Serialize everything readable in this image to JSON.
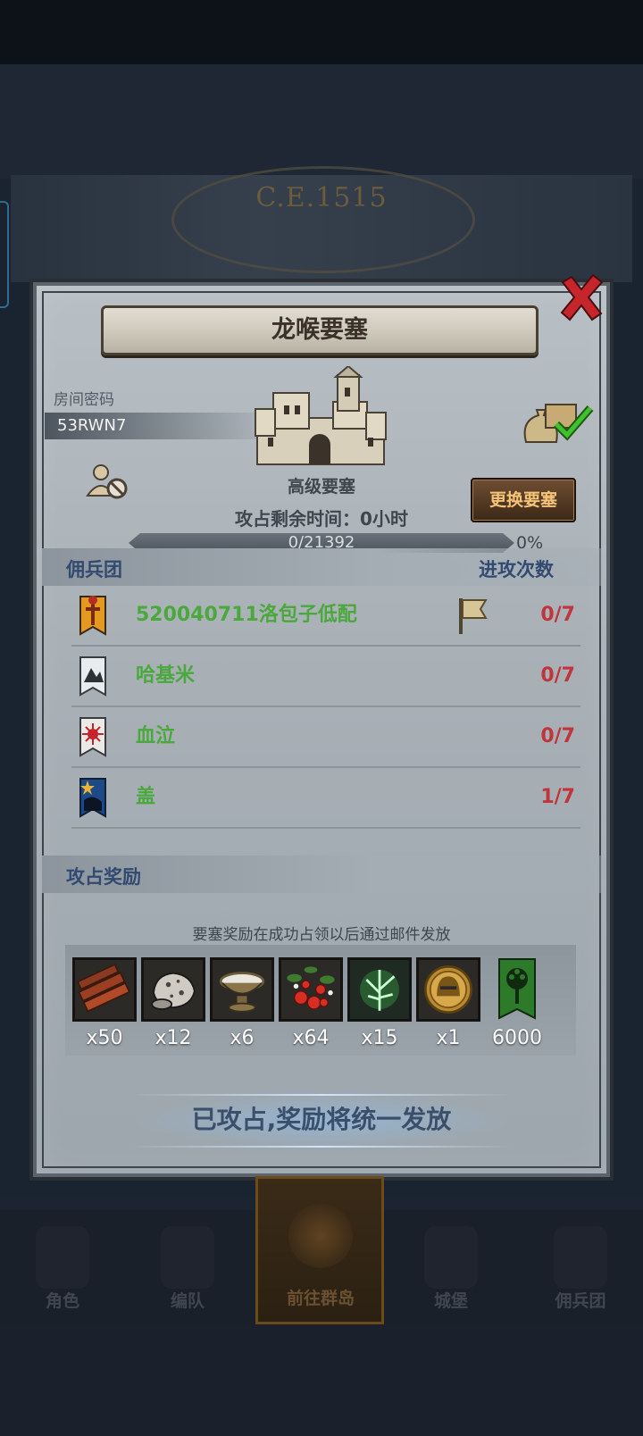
{
  "background": {
    "year_text": "C.E.1515"
  },
  "dialog": {
    "title": "龙喉要塞",
    "room_label": "房间密码",
    "room_code": "53RWN7",
    "fortress_type": "高级要塞",
    "time_left": "攻占剩余时间：0小时",
    "swap_button": "更换要塞",
    "progress": {
      "text": "0/21392",
      "percent_text": "0%",
      "fraction": 0
    }
  },
  "mercenaries": {
    "header_left": "佣兵团",
    "header_right": "进攻次数",
    "rows": [
      {
        "name": "520040711洛包子低配",
        "count": "0/7",
        "banner": "orange-sword-banner",
        "flag": true
      },
      {
        "name": "哈基米",
        "count": "0/7",
        "banner": "silver-mountain-banner",
        "flag": false
      },
      {
        "name": "血泣",
        "count": "0/7",
        "banner": "white-sun-banner",
        "flag": false
      },
      {
        "name": "盖",
        "count": "1/7",
        "banner": "blue-star-banner",
        "flag": false
      }
    ]
  },
  "rewards": {
    "header": "攻占奖励",
    "note": "要塞奖励在成功占领以后通过邮件发放",
    "items": [
      {
        "icon": "wood-planks-icon",
        "amount": "x50"
      },
      {
        "icon": "ore-rock-icon",
        "amount": "x12"
      },
      {
        "icon": "salt-bowl-icon",
        "amount": "x6"
      },
      {
        "icon": "berries-icon",
        "amount": "x64"
      },
      {
        "icon": "green-herb-icon",
        "amount": "x15"
      },
      {
        "icon": "gold-helmet-medal-icon",
        "amount": "x1"
      },
      {
        "icon": "guild-banner-icon",
        "amount": "6000"
      }
    ],
    "status": "已攻占,奖励将统一发放"
  },
  "nav": {
    "items": [
      {
        "label": "角色"
      },
      {
        "label": "编队"
      },
      {
        "label": "前往群岛"
      },
      {
        "label": "城堡"
      },
      {
        "label": "佣兵团"
      }
    ]
  },
  "colors": {
    "name_green": "#4aa83c",
    "count_red": "#c0353c",
    "section_blue": "#334a70"
  }
}
